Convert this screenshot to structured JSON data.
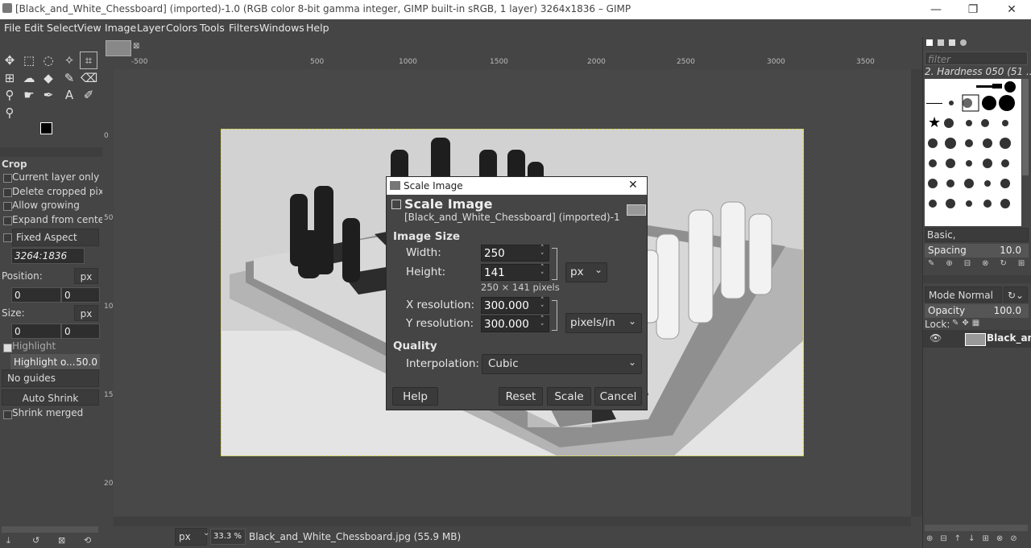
{
  "window": {
    "title": "[Black_and_White_Chessboard] (imported)-1.0 (RGB color 8-bit gamma integer, GIMP built-in sRGB, 1 layer) 3264x1836 – GIMP",
    "minimize": "—",
    "maximize": "❐",
    "close": "✕"
  },
  "menubar": [
    "File",
    "Edit",
    "Select",
    "View",
    "Image",
    "Layer",
    "Colors",
    "Tools",
    "Filters",
    "Windows",
    "Help"
  ],
  "tool_options": {
    "title": "Crop",
    "current_layer_only": "Current layer only",
    "delete_cropped": "Delete cropped pixe",
    "allow_growing": "Allow growing",
    "expand_from_center": "Expand from cente",
    "fixed_aspect": "Fixed Aspect ra...",
    "aspect_value": "3264:1836",
    "position_label": "Position:",
    "position_unit": "px",
    "position_x": "0",
    "position_y": "0",
    "size_label": "Size:",
    "size_unit": "px",
    "size_w": "0",
    "size_h": "0",
    "highlight": "Highlight",
    "highlight_opacity_label": "Highlight o...",
    "highlight_opacity_value": "50.0",
    "guides": "No guides",
    "auto_shrink": "Auto Shrink",
    "shrink_merged": "Shrink merged"
  },
  "rulers": {
    "h_ticks": [
      "-500",
      "500",
      "1000",
      "1500",
      "2000",
      "2500",
      "3000",
      "3500"
    ],
    "v_ticks": [
      "0",
      "500",
      "1000",
      "1500",
      "2000"
    ]
  },
  "statusbar": {
    "unit": "px",
    "zoom": "33.3 %",
    "file_info": "Black_and_White_Chessboard.jpg (55.9 MB)"
  },
  "dialog": {
    "window_title": "Scale Image",
    "close": "✕",
    "heading": "Scale Image",
    "subheading": "[Black_and_White_Chessboard] (imported)-1",
    "image_size_label": "Image Size",
    "width_label": "Width:",
    "width_value": "250",
    "height_label": "Height:",
    "height_value": "141",
    "size_unit": "px",
    "pixel_summary": "250 × 141 pixels",
    "xres_label": "X resolution:",
    "xres_value": "300.000",
    "yres_label": "Y resolution:",
    "yres_value": "300.000",
    "res_unit": "pixels/in",
    "quality_label": "Quality",
    "interp_label": "Interpolation:",
    "interp_value": "Cubic",
    "help": "Help",
    "reset": "Reset",
    "scale": "Scale",
    "cancel": "Cancel"
  },
  "right_dock": {
    "filter_placeholder": "filter",
    "brush_name": "2. Hardness 050 (51 ...",
    "brush_tag": "Basic,",
    "spacing_label": "Spacing",
    "spacing_value": "10.0",
    "mode_label": "Mode Normal",
    "opacity_label": "Opacity",
    "opacity_value": "100.0",
    "lock_label": "Lock:",
    "layer_name": "Black_an"
  },
  "colors": {
    "accent_selection": "#d4d43a",
    "bg": "#454545"
  }
}
